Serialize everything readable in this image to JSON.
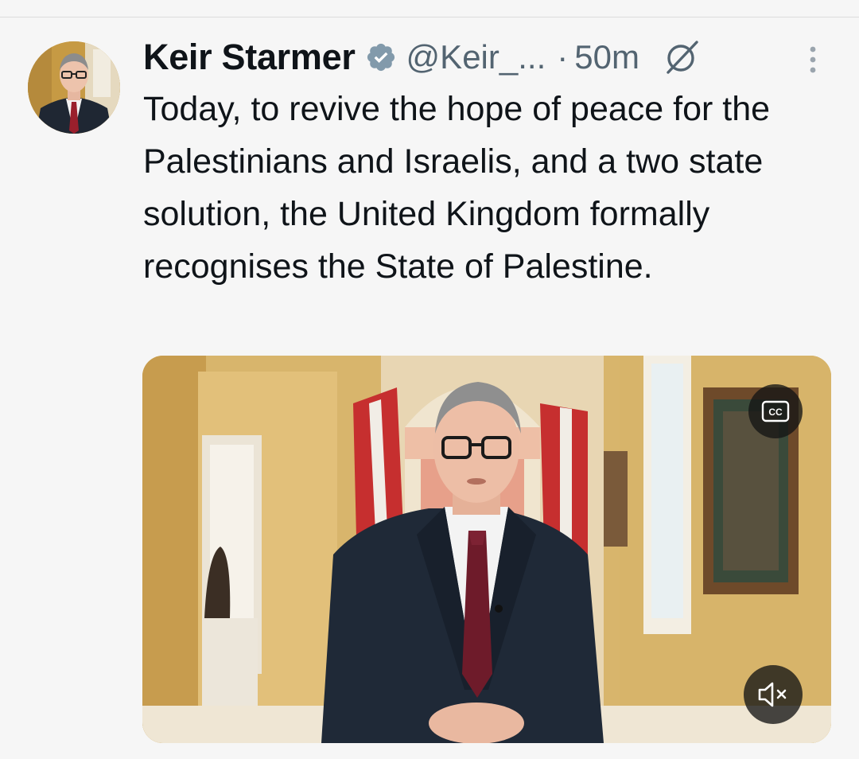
{
  "tweet": {
    "author": {
      "display_name": "Keir Starmer",
      "handle": "@Keir_...",
      "verified": true
    },
    "separator": "·",
    "timestamp": "50m",
    "text": "Today, to revive the hope of peace for the Palestinians and Israelis, and a two state solution, the United Kingdom formally recognises the State of Palestine.",
    "media": {
      "type": "video",
      "captions_label": "CC",
      "muted": true
    }
  },
  "icons": {
    "verified": "verified-badge-icon",
    "grok": "grok-icon",
    "more": "more-vertical-icon",
    "cc": "closed-captions-icon",
    "mute": "volume-muted-icon"
  },
  "colors": {
    "background": "#f6f6f6",
    "text_primary": "#0f1419",
    "text_secondary": "#536471",
    "verified_badge": "#829aab"
  }
}
